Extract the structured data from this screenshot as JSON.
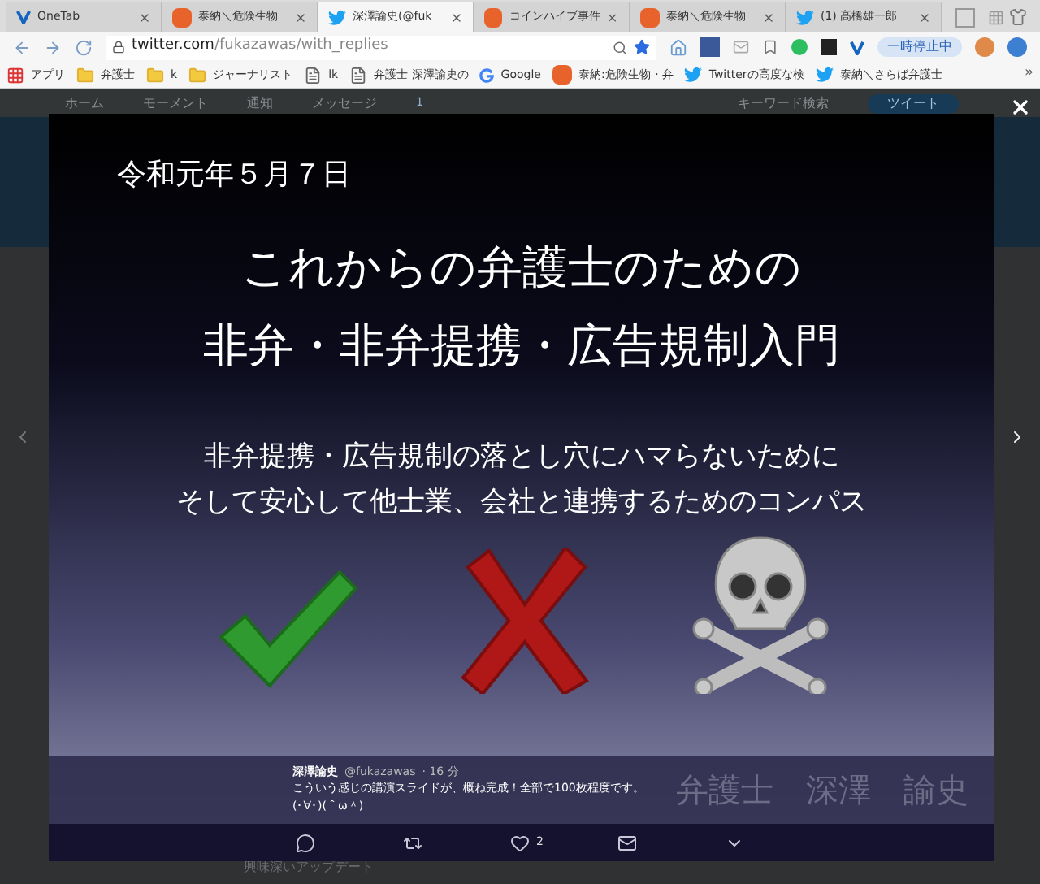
{
  "tabs": [
    {
      "label": "OneTab",
      "selected": false
    },
    {
      "label": "泰納＼危険生物",
      "selected": false
    },
    {
      "label": "深澤諭史(@fuk",
      "selected": true
    },
    {
      "label": "コインハイブ事件",
      "selected": false
    },
    {
      "label": "泰納＼危険生物",
      "selected": false
    },
    {
      "label": "(1) 高橋雄一郎",
      "selected": false
    }
  ],
  "address": {
    "host": "twitter.com",
    "path": "/fukazawas/with_replies"
  },
  "extension_badge": "一時停止中",
  "bookmarks": [
    {
      "label": "アプリ"
    },
    {
      "label": "弁護士"
    },
    {
      "label": "k"
    },
    {
      "label": "ジャーナリスト"
    },
    {
      "label": "lk"
    },
    {
      "label": "弁護士 深澤諭史の"
    },
    {
      "label": "Google"
    },
    {
      "label": "泰納:危険生物・弁"
    },
    {
      "label": "Twitterの高度な検"
    },
    {
      "label": "泰納＼さらば弁護士"
    }
  ],
  "bookmarks_more": "»",
  "background_page": {
    "nav": [
      "ホーム",
      "モーメント",
      "通知",
      "メッセージ"
    ],
    "search_placeholder": "キーワード検索",
    "tweet_button": "ツイート",
    "notification_count": "1",
    "below_text": "興味深いアップデート"
  },
  "slide": {
    "date": "令和元年５月７日",
    "title": [
      "これからの弁護士のための",
      "非弁・非弁提携・広告規制入門"
    ],
    "subtitle": [
      "非弁提携・広告規制の落とし穴にハマらないために",
      "そして安心して他士業、会社と連携するためのコンパス"
    ],
    "speaker": "弁護士　深澤　諭史"
  },
  "tweet": {
    "name": "深澤諭史",
    "handle": "@fukazawas",
    "time": "· 16 分",
    "lines": [
      "こういう感じの講演スライドが、概ね完成！全部で100枚程度です。",
      "(･∀･)(＾ω＾)"
    ]
  },
  "actions": [
    {
      "kind": "reply"
    },
    {
      "kind": "retweet"
    },
    {
      "kind": "like",
      "count": "2"
    },
    {
      "kind": "message"
    },
    {
      "kind": "more"
    }
  ]
}
